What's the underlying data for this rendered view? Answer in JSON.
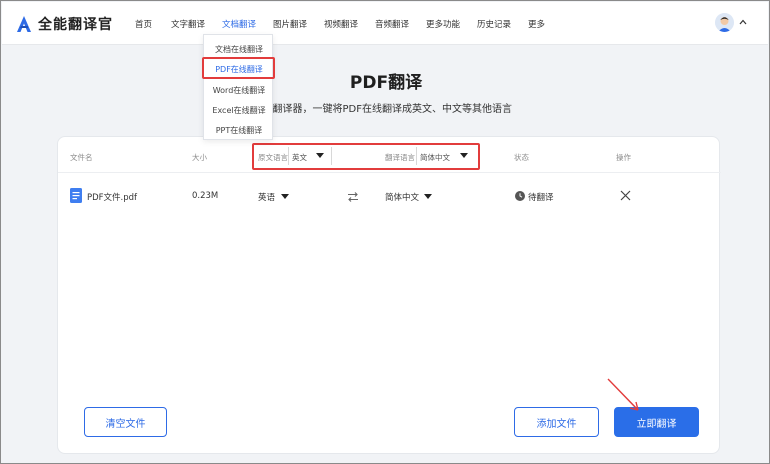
{
  "header": {
    "app_name": "全能翻译官",
    "nav": [
      {
        "label": "首页"
      },
      {
        "label": "文字翻译"
      },
      {
        "label": "文档翻译"
      },
      {
        "label": "图片翻译"
      },
      {
        "label": "视频翻译"
      },
      {
        "label": "音频翻译"
      },
      {
        "label": "更多功能"
      },
      {
        "label": "历史记录"
      },
      {
        "label": "更多"
      }
    ],
    "active_nav": "文档翻译"
  },
  "dropdown": {
    "items": [
      {
        "label": "文档在线翻译"
      },
      {
        "label": "PDF在线翻译"
      },
      {
        "label": "Word在线翻译"
      },
      {
        "label": "Excel在线翻译"
      },
      {
        "label": "PPT在线翻译"
      }
    ],
    "selected": "PDF在线翻译"
  },
  "hero": {
    "title": "PDF翻译",
    "subtitle": "PDF翻译器，一键将PDF在线翻译成英文、中文等其他语言"
  },
  "table": {
    "headers": {
      "file_name": "文件名",
      "size": "大小",
      "source_lang_label": "原文语言",
      "source_lang_value": "英文",
      "target_lang_label": "翻译语言",
      "target_lang_value": "简体中文",
      "status": "状态",
      "action": "操作"
    },
    "rows": [
      {
        "file_name": "PDF文件.pdf",
        "size": "0.23M",
        "source_lang": "英语",
        "target_lang": "简体中文",
        "status": "待翻译"
      }
    ]
  },
  "buttons": {
    "clear": "清空文件",
    "add": "添加文件",
    "translate": "立即翻译"
  },
  "colors": {
    "accent": "#2e6be6",
    "highlight_box": "#e23c3c",
    "page_bg": "#f1f3f6"
  },
  "icons": [
    "logo-icon",
    "avatar-icon",
    "chevron-up-icon",
    "file-icon",
    "swap-icon",
    "clock-icon",
    "close-icon",
    "caret-down-icon",
    "arrow-annotation"
  ]
}
